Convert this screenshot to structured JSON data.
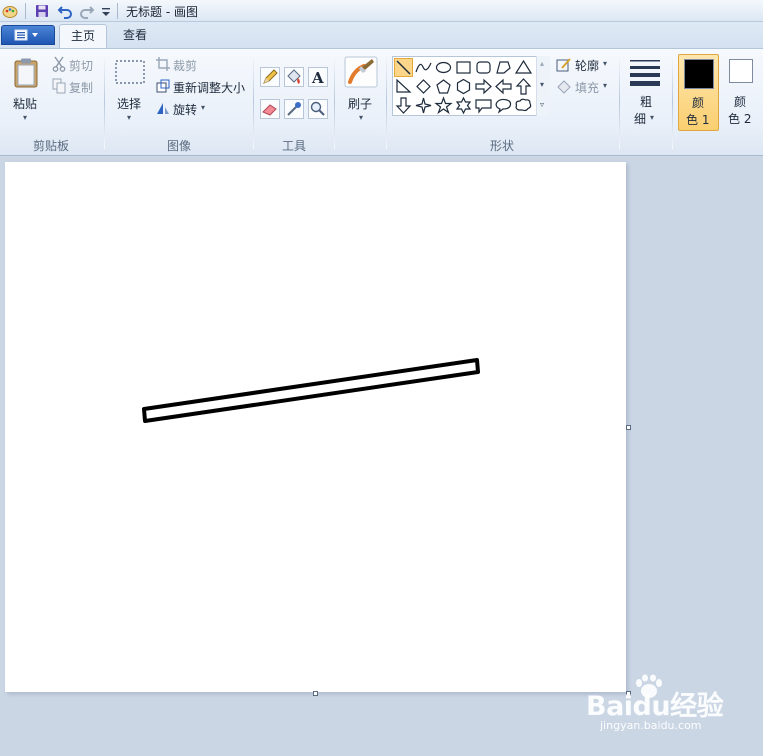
{
  "title_bar": {
    "title": "无标题 - 画图"
  },
  "tabs": {
    "home": "主页",
    "view": "查看"
  },
  "clipboard": {
    "paste": "粘贴",
    "cut": "剪切",
    "copy": "复制",
    "group": "剪贴板"
  },
  "image": {
    "select": "选择",
    "crop": "裁剪",
    "resize": "重新调整大小",
    "rotate": "旋转",
    "group": "图像"
  },
  "tools": {
    "group": "工具"
  },
  "brushes": {
    "label": "刷子"
  },
  "shapes": {
    "outline": "轮廓",
    "fill": "填充",
    "group": "形状"
  },
  "size": {
    "label_line1": "粗",
    "label_line2": "细"
  },
  "colors": {
    "color1_line1": "颜",
    "color1_line2": "色 1",
    "color2_line1": "颜",
    "color2_line2": "色 2",
    "color1_value": "#000000",
    "color2_value": "#ffffff"
  },
  "watermark": {
    "brand": "Baidu经验",
    "url": "jingyan.baidu.com"
  }
}
